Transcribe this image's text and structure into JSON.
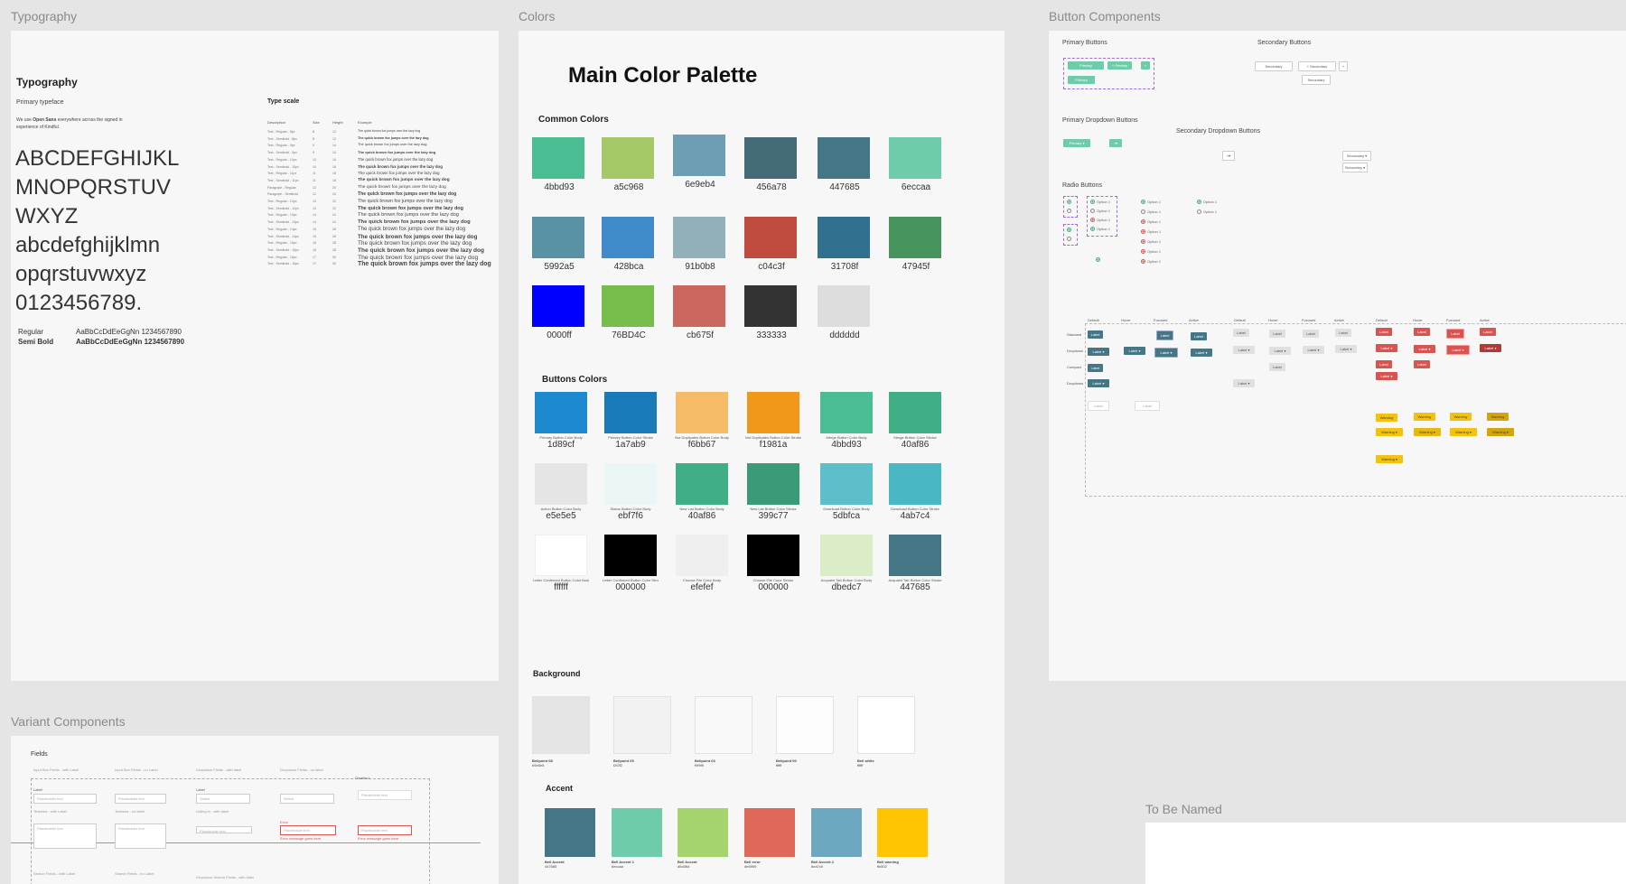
{
  "frames": {
    "typography": "Typography",
    "colors": "Colors",
    "buttons": "Button Components",
    "variants": "Variant Components",
    "tbn": "To Be Named"
  },
  "typography": {
    "heading": "Typography",
    "primary_typeface": "Primary typeface",
    "desc_prefix": "We use ",
    "desc_font": "Open Sans",
    "desc_suffix": " everywhere across the signed in experience of Kindful.",
    "sample_lines": [
      "ABCDEFGHIJKL",
      "MNOPQRSTUV",
      "WXYZ",
      "abcdefghijklmn",
      "opqrstuvwxyz",
      "0123456789."
    ],
    "weights": [
      {
        "name": "Regular",
        "sample": "AaBbCcDdEeGgNn 1234567890"
      },
      {
        "name": "Semi Bold",
        "sample": "AaBbCcDdEeGgNn 1234567890"
      }
    ],
    "type_scale_title": "Type scale",
    "type_scale_headers": [
      "Description",
      "Size",
      "Height",
      "Example"
    ],
    "type_scale_sample": "The quick brown fox jumps over the lazy dog"
  },
  "colors": {
    "title": "Main Color Palette",
    "common_title": "Common Colors",
    "common": [
      [
        "4bbd93",
        "a5c968",
        "6e9eb4",
        "456a78",
        "447685",
        "6eccaa"
      ],
      [
        "5992a5",
        "428bca",
        "91b0b8",
        "c04c3f",
        "31708f",
        "47945f"
      ],
      [
        "0000ff",
        "76BD4C",
        "cb675f",
        "333333",
        "dddddd"
      ]
    ],
    "buttons_title": "Buttons Colors",
    "buttons": [
      [
        {
          "hex": "1d89cf",
          "label": "Primary Button Color Body"
        },
        {
          "hex": "1a7ab9",
          "label": "Primary Button Color Stroke"
        },
        {
          "hex": "f6bb67",
          "label": "Not Duplicates Button Color Body"
        },
        {
          "hex": "f1981a",
          "label": "Not Duplicates Button Color Stroke"
        },
        {
          "hex": "4bbd93",
          "label": "Merge Button Color Body"
        },
        {
          "hex": "40af86",
          "label": "Merge Button Color Stroke"
        }
      ],
      [
        {
          "hex": "e5e5e5",
          "label": "Action Button Color Body"
        },
        {
          "hex": "ebf7f6",
          "label": "Status Button Color Body"
        },
        {
          "hex": "40af86",
          "label": "New List Button Color Body"
        },
        {
          "hex": "399c77",
          "label": "New List Button Color Stroke"
        },
        {
          "hex": "5dbfca",
          "label": "Download Button Color Body"
        },
        {
          "hex": "4ab7c4",
          "label": "Download Button Color Stroke"
        }
      ],
      [
        {
          "hex": "ffffff",
          "label": "Letter Confirmed Button Color Body"
        },
        {
          "hex": "000000",
          "label": "Letter Confirmed Button Color Stroke"
        },
        {
          "hex": "efefef",
          "label": "Choose File Color Body"
        },
        {
          "hex": "000000",
          "label": "Choose File Color Stroke"
        },
        {
          "hex": "dbedc7",
          "label": "Acquaint Tab Button Color Body"
        },
        {
          "hex": "447685",
          "label": "Acquaint Tab Button Color Stroke"
        }
      ]
    ],
    "background_title": "Background",
    "background": [
      {
        "name": "Bellpoint 08",
        "hex": "e5e5e5",
        "fill": "#e5e5e5"
      },
      {
        "name": "Bellpoint 05",
        "hex": "f2f2f2",
        "fill": "#f2f2f2"
      },
      {
        "name": "Bellpoint 03",
        "hex": "f9f9f9",
        "fill": "#f9f9f9"
      },
      {
        "name": "Bellpoint 00",
        "hex": "ffffff",
        "fill": "#fdfdfd"
      },
      {
        "name": "Bell white",
        "hex": "ffffff",
        "fill": "#ffffff"
      }
    ],
    "accent_title": "Accent",
    "accent": [
      {
        "name": "Bell Accent",
        "hex": "447685",
        "fill": "#447685"
      },
      {
        "name": "Bell Accent 1",
        "hex": "6eccaa",
        "fill": "#6eccaa"
      },
      {
        "name": "Bell Accent",
        "hex": "a5d36d",
        "fill": "#a5d36d"
      },
      {
        "name": "Bell error",
        "hex": "de6959",
        "fill": "#de6959"
      },
      {
        "name": "Bell Accent 2",
        "hex": "6ea7c0",
        "fill": "#6ea7c0"
      },
      {
        "name": "Bell warning",
        "hex": "ffc502",
        "fill": "#ffc502"
      }
    ]
  },
  "buttons": {
    "primary_title": "Primary Buttons",
    "secondary_title": "Secondary Buttons",
    "primary_dd_title": "Primary Dropdown Buttons",
    "secondary_dd_title": "Secondary Dropdown Buttons",
    "radio_title": "Radio Buttons",
    "primary_label": "Primary",
    "secondary_label": "Secondary",
    "option_label": "Option 1",
    "label": "Label",
    "warning": "Warning",
    "state_headers": [
      "Default",
      "Hover",
      "Focused",
      "Active"
    ],
    "row_headers": [
      "Standard",
      "Dropdown",
      "Compact",
      "Dropdown"
    ]
  },
  "variants": {
    "fields_title": "Fields",
    "col_headers": [
      "Input Box Fields - with Label",
      "Input Box Fields - no Label",
      "Dropdown Fields - with label",
      "Dropdown Fields - no label",
      "Disabled"
    ],
    "placeholder": "Placeholder text",
    "label": "Label",
    "error": "Error",
    "select": "Select",
    "error_text": "Error message goes here",
    "rows": [
      "Textarea - with Label",
      "Textarea - no label",
      "Listing tx - with label"
    ],
    "bottom": [
      "Search Fields - with Label",
      "Search Fields - no Label",
      "Dropdown Search Fields - with label"
    ]
  },
  "colors_hex": {
    "common": [
      [
        "#4bbd93",
        "#a5c968",
        "#6e9eb4",
        "#456a78",
        "#447685",
        "#6eccaa"
      ],
      [
        "#5992a5",
        "#428bca",
        "#91b0b8",
        "#c04c3f",
        "#31708f",
        "#47945f"
      ],
      [
        "#0000ff",
        "#76bd4c",
        "#cb675f",
        "#333333",
        "#dddddd"
      ]
    ],
    "buttons": [
      [
        "#1d89cf",
        "#1a7ab9",
        "#f6bb67",
        "#f1981a",
        "#4bbd93",
        "#40af86"
      ],
      [
        "#e5e5e5",
        "#ebf7f6",
        "#40af86",
        "#399c77",
        "#5dbfca",
        "#4ab7c4"
      ],
      [
        "#ffffff",
        "#000000",
        "#efefef",
        "#000000",
        "#dbedc7",
        "#447685"
      ]
    ]
  }
}
